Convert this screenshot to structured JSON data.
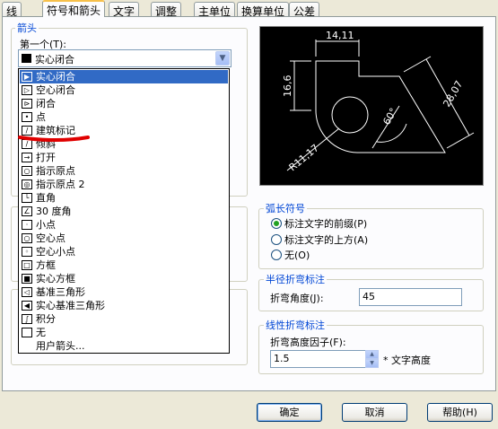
{
  "tabs": [
    "线",
    "符号和箭头",
    "文字",
    "调整",
    "主单位",
    "换算单位",
    "公差"
  ],
  "arrows": {
    "group_title": "箭头",
    "first_label": "第一个(T):",
    "first_value": "实心闭合",
    "options": [
      "实心闭合",
      "空心闭合",
      "闭合",
      "点",
      "建筑标记",
      "倾斜",
      "打开",
      "指示原点",
      "指示原点 2",
      "直角",
      "30 度角",
      "小点",
      "空心点",
      "空心小点",
      "方框",
      "实心方框",
      "基准三角形",
      "实心基准三角形",
      "积分",
      "无",
      "用户箭头..."
    ],
    "selected_index": 0,
    "icons": [
      "solid-closed-arrow-icon",
      "hollow-closed-arrow-icon",
      "closed-arrow-icon",
      "dot-icon",
      "architectural-tick-icon",
      "oblique-icon",
      "open-arrow-icon",
      "origin-indicator-icon",
      "origin-indicator-2-icon",
      "right-angle-icon",
      "open-30-icon",
      "small-dot-icon",
      "hollow-dot-icon",
      "hollow-small-dot-icon",
      "box-icon",
      "solid-box-icon",
      "datum-triangle-icon",
      "solid-datum-triangle-icon",
      "integral-icon",
      "none-icon",
      "user-arrow-icon"
    ]
  },
  "preview": {
    "dim_top": "14,11",
    "dim_left": "16,6",
    "dim_right": "28,07",
    "dim_angle": "60°",
    "dim_radius": "R11,17"
  },
  "arc_symbol": {
    "title": "弧长符号",
    "options": [
      "标注文字的前缀(P)",
      "标注文字的上方(A)",
      "无(O)"
    ],
    "selected": 0
  },
  "radius_jog": {
    "title": "半径折弯标注",
    "label": "折弯角度(J):",
    "value": "45"
  },
  "linear_jog": {
    "title": "线性折弯标注",
    "label": "折弯高度因子(F):",
    "value": "1.5",
    "suffix": "* 文字高度"
  },
  "buttons": {
    "ok": "确定",
    "cancel": "取消",
    "help": "帮助(H)"
  },
  "colors": {
    "selection": "#316ac5",
    "group_title": "#0046d5",
    "red_mark": "#e00000"
  }
}
